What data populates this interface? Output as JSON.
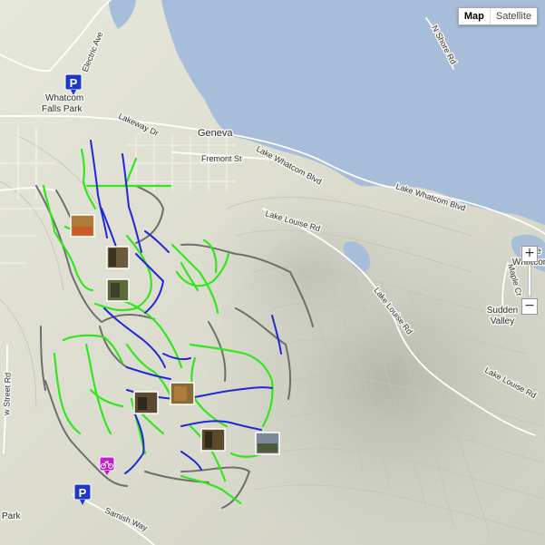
{
  "map_type": {
    "map": "Map",
    "satellite": "Satellite",
    "selected": "Map"
  },
  "zoom": {
    "in": "+",
    "out": "−"
  },
  "labels": {
    "park": "Whatcom\nFalls Park",
    "electric": "Electric Ave",
    "lakeway": "Lakeway Dr",
    "geneva": "Geneva",
    "fremont": "Fremont St",
    "lake_whatcom_blvd_1": "Lake Whatcom Blvd",
    "lake_whatcom_blvd_2": "Lake Whatcom Blvd",
    "lake_louise_1": "Lake Louise Rd",
    "lake_louise_2": "Lake Louise Rd",
    "lake_louise_3": "Lake Louise Rd",
    "n_shore": "N Shore Rd",
    "maple": "Maple Cr",
    "sudden": "Sudden\nValley",
    "lake_whatcom_edge": "Lake\nWhatcom",
    "samish": "Samish Way",
    "w_street": "w Street Rd",
    "park_edge": "Park"
  },
  "markers": {
    "parking": "P"
  },
  "colors": {
    "land": "#e8e8dc",
    "water": "#a7bdd9",
    "trail_easy": "#34e61f",
    "trail_hard": "#1f27d6",
    "road": "#7d7d7d",
    "bike_marker": "#c020c8",
    "parking": "#1b39c4"
  },
  "icons": [
    "parking-icon",
    "bike-icon",
    "photo-thumbnail"
  ]
}
